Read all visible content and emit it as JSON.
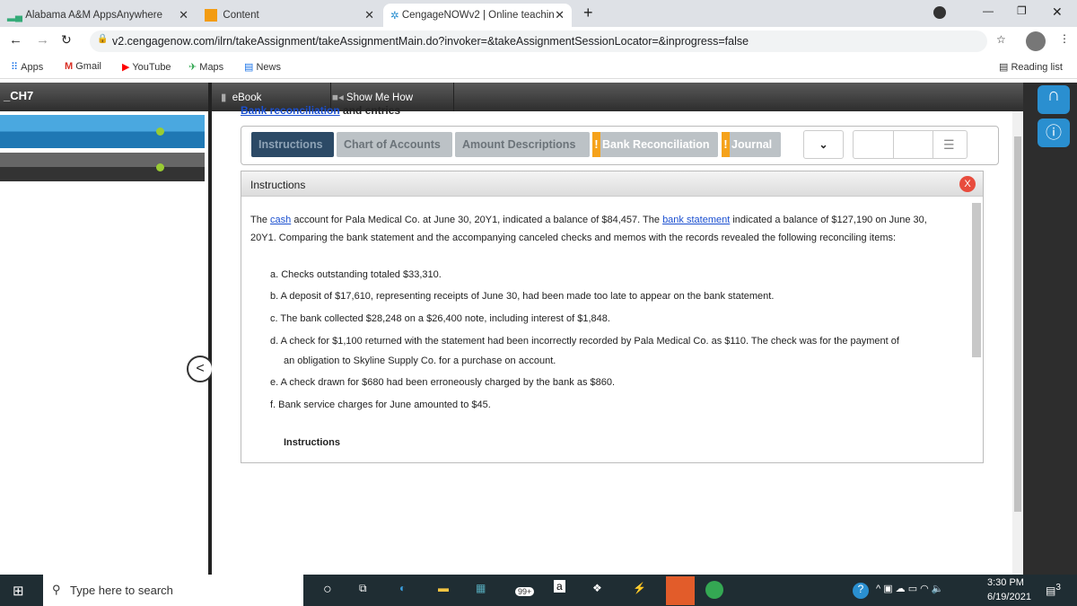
{
  "browser": {
    "tabs": [
      {
        "label": "Alabama A&M AppsAnywhere"
      },
      {
        "label": "Content"
      },
      {
        "label": "CengageNOWv2 | Online teachin"
      }
    ],
    "url": "v2.cengagenow.com/ilrn/takeAssignment/takeAssignmentMain.do?invoker=&takeAssignmentSessionLocator=&inprogress=false",
    "bookmarks": [
      "Apps",
      "Gmail",
      "YouTube",
      "Maps",
      "News"
    ],
    "reading_list": "Reading list"
  },
  "app": {
    "assignment_title": "_CH7",
    "ebook": "eBook",
    "show_me_how": "Show Me How",
    "heading_link": "Bank reconciliation",
    "heading_rest": " and entries",
    "tabs": [
      {
        "label": "Instructions",
        "active": true
      },
      {
        "label": "Chart of Accounts"
      },
      {
        "label": "Amount Descriptions"
      },
      {
        "label": "Bank Reconciliation",
        "warning": true
      },
      {
        "label": "Journal",
        "warning": true
      }
    ],
    "accent": "#2c4a66",
    "warning_color": "#f5a21b"
  },
  "panel": {
    "title": "Instructions",
    "p1_a": "The ",
    "p1_link1": "cash",
    "p1_b": " account for Pala Medical Co. at June 30, 20Y1, indicated a balance of $84,457. The ",
    "p1_link2": "bank statement",
    "p1_c": " indicated a balance of $127,190 on June 30,",
    "p2": "20Y1. Comparing the bank statement and the accompanying canceled checks and memos with the records revealed the following reconciling items:",
    "items": [
      "a. Checks outstanding totaled $33,310.",
      "b. A deposit of $17,610, representing receipts of June 30, had been made too late to appear on the bank statement.",
      "c. The bank collected $28,248 on a $26,400 note, including interest of $1,848.",
      "d. A check for $1,100 returned with the statement had been incorrectly recorded by Pala Medical Co. as $110. The check was for the payment of",
      "an obligation to Skyline Supply Co. for a purchase on account.",
      "e. A check drawn for $680 had been erroneously charged by the bank as $860.",
      "f. Bank service charges for June amounted to $45."
    ],
    "footer": "Instructions"
  },
  "taskbar": {
    "search_placeholder": "Type here to search",
    "time": "3:30 PM",
    "date": "6/19/2021",
    "mail_badge": "99+",
    "notif_count": "3"
  }
}
